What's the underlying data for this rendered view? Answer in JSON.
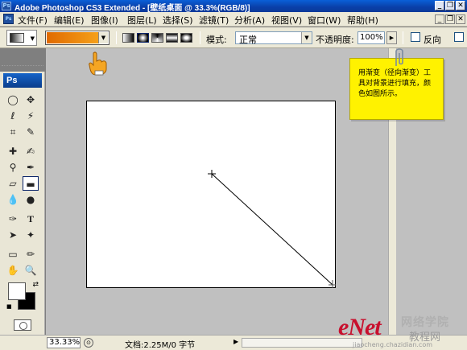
{
  "window": {
    "title": "Adobe Photoshop CS3 Extended - [壁纸桌面 @ 33.3%(RGB/8)]",
    "app_badge": "Ps"
  },
  "menu": {
    "items": [
      "文件(F)",
      "编辑(E)",
      "图像(I)",
      "图层(L)",
      "选择(S)",
      "滤镜(T)",
      "分析(A)",
      "视图(V)",
      "窗口(W)",
      "帮助(H)"
    ]
  },
  "options": {
    "mode_label": "模式:",
    "mode_value": "正常",
    "opacity_label": "不透明度:",
    "opacity_value": "100%",
    "reverse_label": "反向",
    "gradient_colors": [
      "#e06a00",
      "#f5a01a"
    ]
  },
  "toolbox": {
    "logo": "Ps"
  },
  "callout": {
    "text": "用渐变（径向渐变）工具对背景进行填充，颜色如图所示。"
  },
  "statusbar": {
    "zoom": "33.33%",
    "doc_info": "文档:2.25M/0 字节"
  },
  "watermark": {
    "brand": "eNet",
    "cn_line1": "网络学院",
    "cn_line2": "教程网",
    "url": "jiaocheng.chazidian.com"
  },
  "icons": [
    "gradient-tool-icon",
    "hand-pointer-icon",
    "paperclip-icon",
    "crosshair-icon"
  ]
}
